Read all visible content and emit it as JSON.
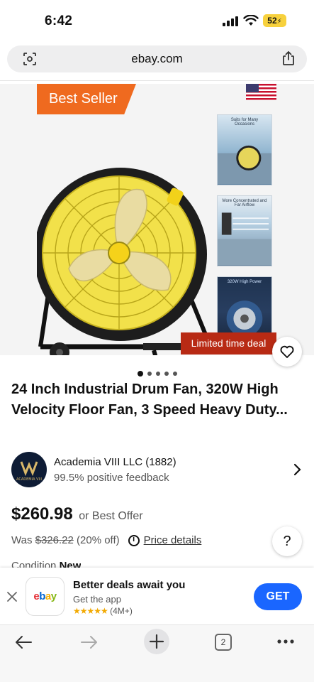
{
  "status_bar": {
    "time": "6:42",
    "battery": "52"
  },
  "browser": {
    "url": "ebay.com"
  },
  "gallery": {
    "badge": "Best Seller",
    "deal_label": "Limited time deal",
    "thumbnails": [
      {
        "caption": "Suits for Many Occasions"
      },
      {
        "caption": "More Concentrated and Far Airflow"
      },
      {
        "caption": "320W High Power"
      }
    ],
    "image_count": 5,
    "active_image": 1
  },
  "product": {
    "title": "24 Inch Industrial Drum Fan, 320W High Velocity Floor Fan, 3 Speed Heavy Duty...",
    "price": "$260.98",
    "best_offer": "or Best Offer",
    "was_label": "Was",
    "was_price": "$326.22",
    "discount": "(20% off)",
    "price_details": "Price details",
    "condition_label": "Condition",
    "condition_value": "New"
  },
  "seller": {
    "name": "Academia VIII LLC (1882)",
    "feedback": "99.5% positive feedback",
    "avatar_text": "ACADEMIA VIII"
  },
  "app_banner": {
    "logo": "ebay",
    "title": "Better deals await you",
    "subtitle": "Get the app",
    "stars": "★★★★★",
    "rating_count": "(4M+)",
    "cta": "GET"
  },
  "toolbar": {
    "tab_count": "2"
  },
  "colors": {
    "best_seller": "#ef6a1f",
    "limited_deal": "#b82a14",
    "get_button": "#1a66ff",
    "fan_yellow": "#f2e14a"
  }
}
